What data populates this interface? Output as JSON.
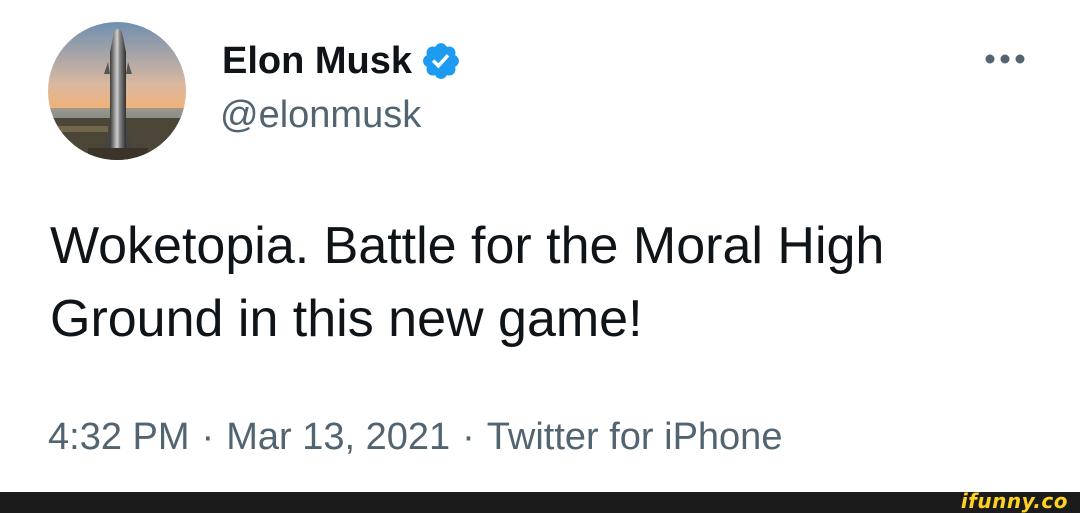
{
  "user": {
    "display_name": "Elon Musk",
    "handle": "@elonmusk",
    "avatar_icon": "starship-rocket-avatar",
    "verified_icon": "verified-badge-icon"
  },
  "tweet": {
    "text": "Woketopia. Battle for the Moral High Ground in this new game!"
  },
  "meta": {
    "time": "4:32 PM",
    "separator": "·",
    "date": "Mar 13, 2021",
    "source": "Twitter for iPhone"
  },
  "more_menu_icon": "more-horizontal-icon",
  "watermark": {
    "text": "ifunny.co"
  },
  "colors": {
    "text_primary": "#0f1419",
    "text_secondary": "#536471",
    "verified_blue": "#1d9bf0",
    "footer_bg": "#1b1b1b",
    "watermark": "#ffd21f"
  }
}
